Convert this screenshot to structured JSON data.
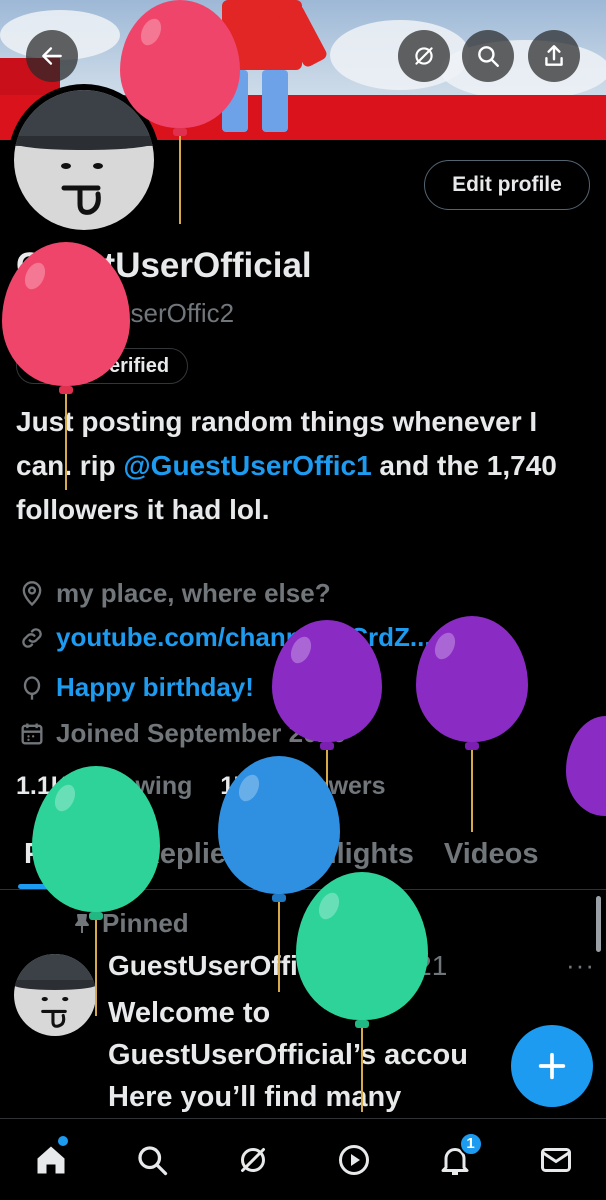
{
  "header": {
    "back_icon": "arrow-left-icon",
    "grok_icon": "grok-icon",
    "search_icon": "search-icon",
    "share_icon": "share-icon"
  },
  "profile": {
    "edit_label": "Edit profile",
    "display_name": "GuestUserOfficial",
    "handle": "@GuestUserOffic2",
    "verify_label": "Get verified",
    "bio_part1": "Just posting random things whenever I can. rip ",
    "bio_mention": "@GuestUserOffic1",
    "bio_part2": " and the 1,740 followers it had lol.",
    "location": "my place, where else?",
    "website": "youtube.com/channel/UCrdZ...",
    "birthday": "Happy birthday!",
    "joined": "Joined September 2020",
    "following_count": "1.1K",
    "following_label": "Following",
    "followers_count": "175",
    "followers_label": "Followers"
  },
  "tabs": [
    "Posts",
    "Replies",
    "Highlights",
    "Videos"
  ],
  "active_tab": "Posts",
  "tweet": {
    "pinned_label": "Pinned",
    "author": "GuestUserOfficial",
    "separator": "·",
    "date": "2/4/21",
    "more": "···",
    "line1": "Welcome to",
    "line2": "GuestUserOfficial’s accou",
    "line3": "Here you’ll find many"
  },
  "fab_icon": "plus-icon",
  "nav": {
    "items": [
      "home-icon",
      "search-icon",
      "grok-icon",
      "play-icon",
      "bell-icon",
      "mail-icon"
    ],
    "notification_count": "1"
  },
  "colors": {
    "accent": "#1d9bf0",
    "secondary_text": "#71767b",
    "balloon_pink": "#f0456b",
    "balloon_purple": "#8a2bc4",
    "balloon_green": "#2ed39a",
    "balloon_blue": "#2f8fe0"
  }
}
